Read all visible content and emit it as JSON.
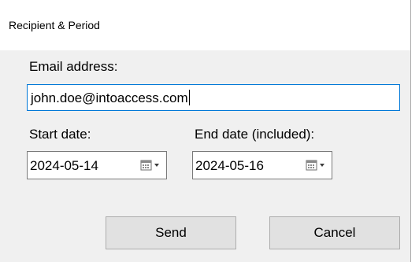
{
  "window": {
    "title": "Recipient & Period"
  },
  "email": {
    "label": "Email address:",
    "value": "john.doe@intoaccess.com"
  },
  "start_date": {
    "label": "Start date:",
    "value": "2024-05-14",
    "icon": "calendar-dropdown-icon"
  },
  "end_date": {
    "label": "End date (included):",
    "value": "2024-05-16",
    "icon": "calendar-dropdown-icon"
  },
  "buttons": {
    "send": "Send",
    "cancel": "Cancel"
  },
  "colors": {
    "focus_border": "#0078d7",
    "dialog_background": "#f0f0f0",
    "button_face": "#e1e1e1"
  }
}
